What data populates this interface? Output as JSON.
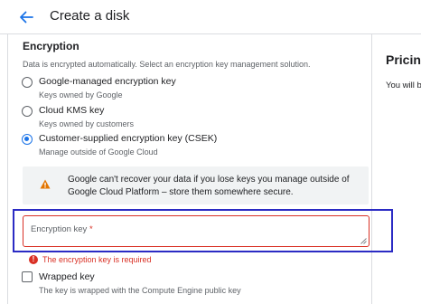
{
  "header": {
    "title": "Create a disk",
    "back_icon": "arrow-left-icon"
  },
  "encryption": {
    "title": "Encryption",
    "description": "Data is encrypted automatically. Select an encryption key management solution.",
    "options": [
      {
        "label": "Google-managed encryption key",
        "sublabel": "Keys owned by Google",
        "selected": false
      },
      {
        "label": "Cloud KMS key",
        "sublabel": "Keys owned by customers",
        "selected": false
      },
      {
        "label": "Customer-supplied encryption key (CSEK)",
        "sublabel": "Manage outside of Google Cloud",
        "selected": true
      }
    ],
    "warning": {
      "icon": "warning-icon",
      "text": "Google can't recover your data if you lose keys you manage outside of Google Cloud Platform – store them somewhere secure."
    },
    "key_field": {
      "placeholder": "Encryption key",
      "required_mark": "*",
      "value": "",
      "error": "The encryption key is required"
    },
    "wrapped_key": {
      "label": "Wrapped key",
      "sublabel": "The key is wrapped with the Compute Engine public key",
      "checked": false
    }
  },
  "pricing": {
    "title": "Pricing",
    "text": "You will be billed"
  },
  "colors": {
    "accent": "#1a73e8",
    "error": "#d93025",
    "warning": "#e37400",
    "highlight_frame": "#2b2bc4"
  }
}
